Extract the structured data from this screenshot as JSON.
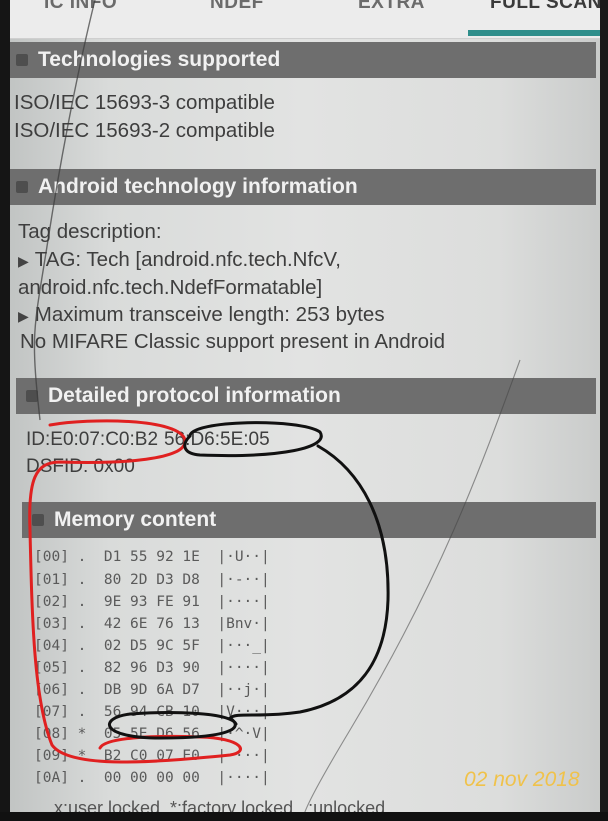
{
  "tabs": [
    {
      "label": "IC INFO"
    },
    {
      "label": "NDEF"
    },
    {
      "label": "EXTRA"
    },
    {
      "label": "FULL SCAN"
    }
  ],
  "sections": {
    "technologies": {
      "title": "Technologies supported",
      "lines": [
        "ISO/IEC 15693-3 compatible",
        "ISO/IEC 15693-2 compatible"
      ]
    },
    "android": {
      "title": "Android technology information",
      "tag_description": "Tag description:",
      "tag_line1": "TAG: Tech [android.nfc.tech.NfcV,",
      "tag_line2": "android.nfc.tech.NdefFormatable]",
      "max_transceive": "Maximum transceive length: 253 bytes",
      "mifare": "No MIFARE Classic support present in Android"
    },
    "protocol": {
      "title": "Detailed protocol information",
      "id_label": "ID:",
      "id_part1": "E0:07:C0:B2",
      "id_part2": "56:D6:5E:05",
      "dsfid": "DSFID: 0x00"
    },
    "memory": {
      "title": "Memory content",
      "rows": [
        {
          "addr": "[00]",
          "flag": ".",
          "bytes": "D1 55 92 1E",
          "ascii": "|·U··|"
        },
        {
          "addr": "[01]",
          "flag": ".",
          "bytes": "80 2D D3 D8",
          "ascii": "|·-··|"
        },
        {
          "addr": "[02]",
          "flag": ".",
          "bytes": "9E 93 FE 91",
          "ascii": "|····|"
        },
        {
          "addr": "[03]",
          "flag": ".",
          "bytes": "42 6E 76 13",
          "ascii": "|Bnv·|"
        },
        {
          "addr": "[04]",
          "flag": ".",
          "bytes": "02 D5 9C 5F",
          "ascii": "|···_|"
        },
        {
          "addr": "[05]",
          "flag": ".",
          "bytes": "82 96 D3 90",
          "ascii": "|····|"
        },
        {
          "addr": "[06]",
          "flag": ".",
          "bytes": "DB 9D 6A D7",
          "ascii": "|··j·|"
        },
        {
          "addr": "[07]",
          "flag": ".",
          "bytes": "56 94 CB 10",
          "ascii": "|V···|"
        },
        {
          "addr": "[08]",
          "flag": "*",
          "bytes": "05 5E D6 56",
          "ascii": "|·^·V|"
        },
        {
          "addr": "[09]",
          "flag": "*",
          "bytes": "B2 C0 07 E0",
          "ascii": "|····|"
        },
        {
          "addr": "[0A]",
          "flag": ".",
          "bytes": "00 00 00 00",
          "ascii": "|····|"
        }
      ],
      "legend": "x:user locked, *:factory locked, .:unlocked"
    }
  },
  "date_stamp": "02 nov 2018",
  "colors": {
    "accent": "#2f8e8b",
    "section_header": "#6e6e6e",
    "annotation_red": "#e02020",
    "annotation_black": "#111111",
    "date_stamp": "#f0c24a"
  }
}
